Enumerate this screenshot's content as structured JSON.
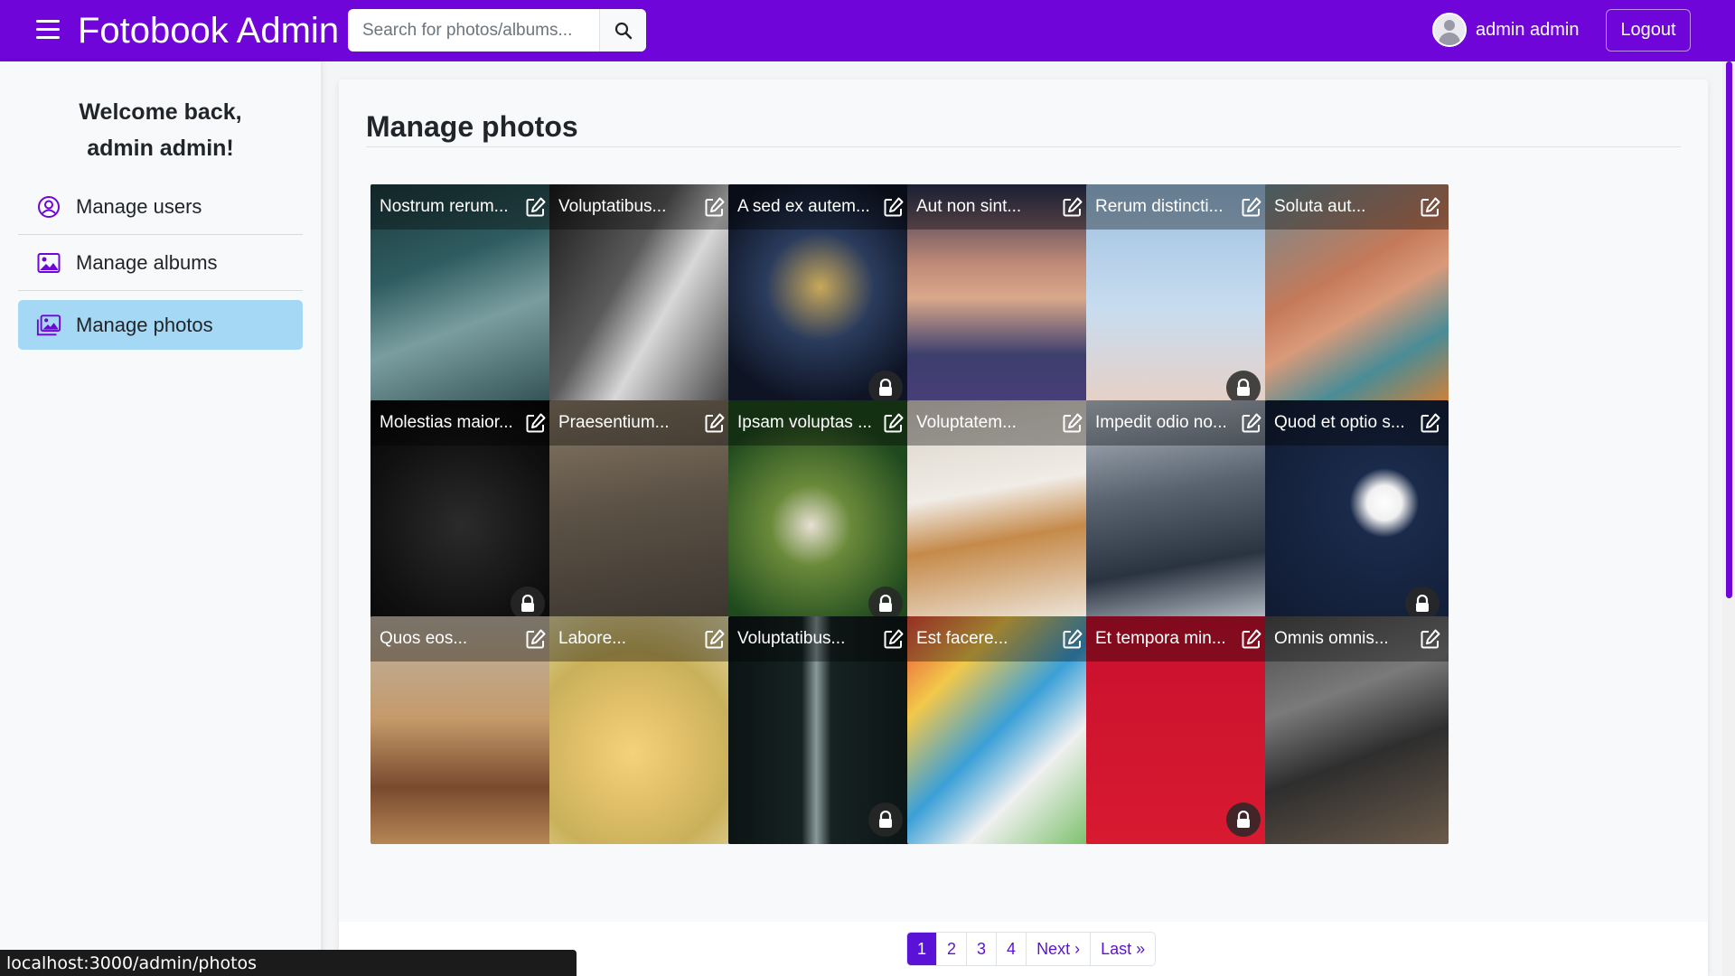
{
  "navbar": {
    "brand": "Fotobook Admin",
    "search_placeholder": "Search for photos/albums...",
    "user_name": "admin admin",
    "logout_label": "Logout",
    "bg_color": "#6f05d9"
  },
  "sidebar": {
    "welcome_line1": "Welcome back,",
    "welcome_line2": "admin admin!",
    "items": [
      {
        "label": "Manage users",
        "icon": "user-circle-icon",
        "active": false
      },
      {
        "label": "Manage albums",
        "icon": "image-icon",
        "active": false
      },
      {
        "label": "Manage photos",
        "icon": "images-icon",
        "active": true
      }
    ]
  },
  "main": {
    "title": "Manage photos",
    "photos": [
      {
        "caption": "Nostrum rerum...",
        "locked": false
      },
      {
        "caption": "Voluptatibus...",
        "locked": false
      },
      {
        "caption": "A sed ex autem...",
        "locked": true
      },
      {
        "caption": "Aut non sint...",
        "locked": false
      },
      {
        "caption": "Rerum distincti...",
        "locked": true
      },
      {
        "caption": "Soluta aut...",
        "locked": false
      },
      {
        "caption": "Molestias maior...",
        "locked": true
      },
      {
        "caption": "Praesentium...",
        "locked": false
      },
      {
        "caption": "Ipsam voluptas ...",
        "locked": true
      },
      {
        "caption": "Voluptatem...",
        "locked": false
      },
      {
        "caption": "Impedit odio no...",
        "locked": false
      },
      {
        "caption": "Quod et optio s...",
        "locked": true
      },
      {
        "caption": "Quos eos...",
        "locked": false
      },
      {
        "caption": "Labore...",
        "locked": false
      },
      {
        "caption": "Voluptatibus...",
        "locked": true
      },
      {
        "caption": "Est facere...",
        "locked": false
      },
      {
        "caption": "Et tempora min...",
        "locked": true
      },
      {
        "caption": "Omnis omnis...",
        "locked": false
      }
    ]
  },
  "pagination": {
    "pages": [
      "1",
      "2",
      "3",
      "4"
    ],
    "next_label": "Next ›",
    "last_label": "Last »",
    "current": "1"
  },
  "status_bar": {
    "url": "localhost:3000/admin/photos"
  }
}
